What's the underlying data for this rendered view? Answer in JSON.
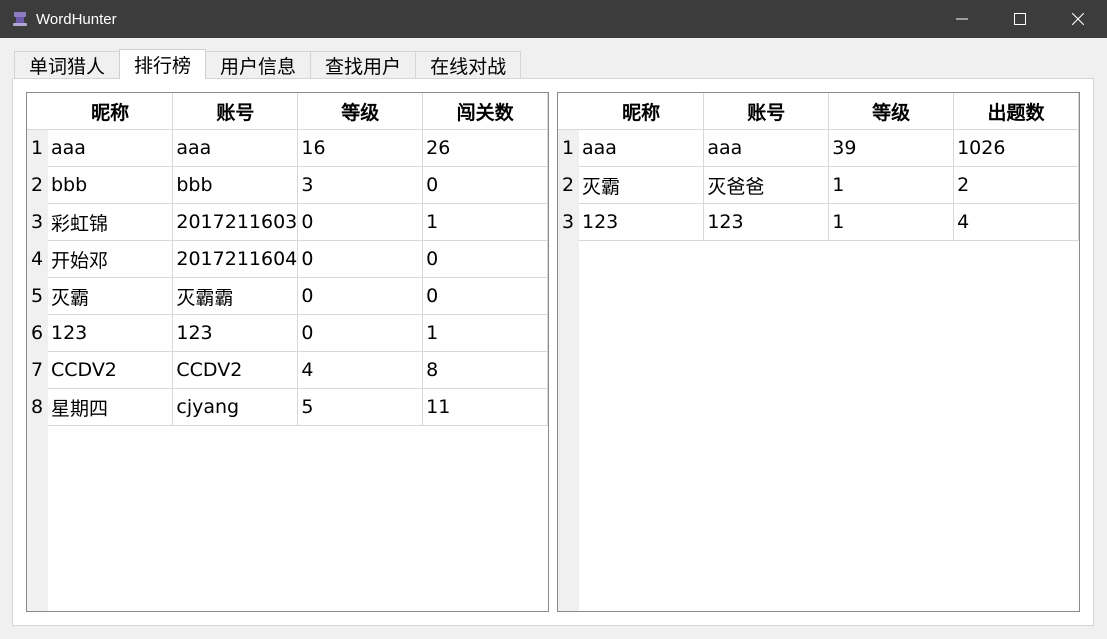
{
  "window": {
    "title": "WordHunter",
    "accent": "#3c3c3c"
  },
  "tabs": [
    {
      "label": "单词猎人",
      "active": false
    },
    {
      "label": "排行榜",
      "active": true
    },
    {
      "label": "用户信息",
      "active": false
    },
    {
      "label": "查找用户",
      "active": false
    },
    {
      "label": "在线对战",
      "active": false
    }
  ],
  "level_rank": {
    "headers": [
      "昵称",
      "账号",
      "等级",
      "闯关数"
    ],
    "rows": [
      [
        "1",
        "aaa",
        "aaa",
        "16",
        "26"
      ],
      [
        "2",
        "bbb",
        "bbb",
        "3",
        "0"
      ],
      [
        "3",
        "彩虹锦",
        "2017211603",
        "0",
        "1"
      ],
      [
        "4",
        "开始邓",
        "2017211604",
        "0",
        "0"
      ],
      [
        "5",
        "灭霸",
        "灭霸霸",
        "0",
        "0"
      ],
      [
        "6",
        "123",
        "123",
        "0",
        "1"
      ],
      [
        "7",
        "CCDV2",
        "CCDV2",
        "4",
        "8"
      ],
      [
        "8",
        "星期四",
        "cjyang",
        "5",
        "11"
      ]
    ]
  },
  "question_rank": {
    "headers": [
      "昵称",
      "账号",
      "等级",
      "出题数"
    ],
    "rows": [
      [
        "1",
        "aaa",
        "aaa",
        "39",
        "1026"
      ],
      [
        "2",
        "灭霸",
        "灭爸爸",
        "1",
        "2"
      ],
      [
        "3",
        "123",
        "123",
        "1",
        "4"
      ]
    ]
  }
}
